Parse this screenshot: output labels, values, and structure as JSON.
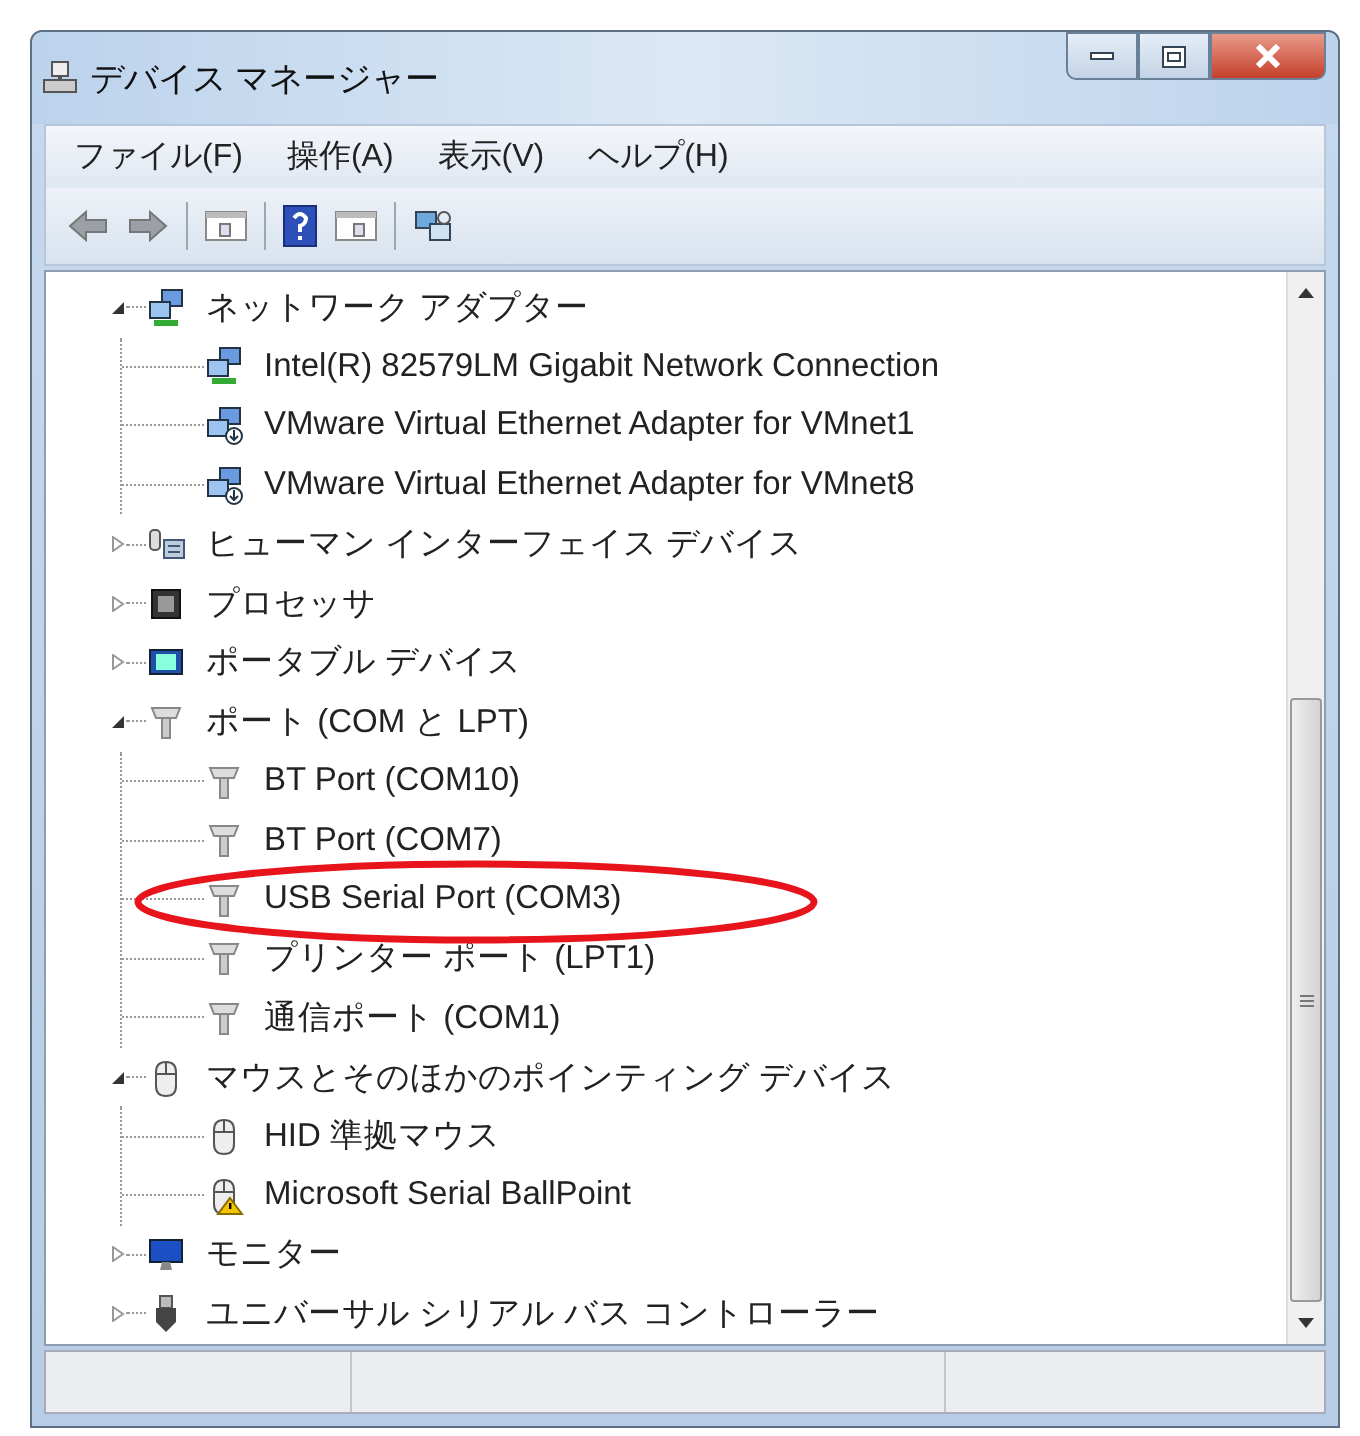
{
  "window": {
    "title": "デバイス マネージャー"
  },
  "menu": [
    "ファイル(F)",
    "操作(A)",
    "表示(V)",
    "ヘルプ(H)"
  ],
  "tree": [
    {
      "label": "ネットワーク アダプター",
      "kind": "network",
      "expanded": true,
      "children": [
        {
          "label": "Intel(R) 82579LM Gigabit Network Connection",
          "kind": "network"
        },
        {
          "label": "VMware Virtual Ethernet Adapter for VMnet1",
          "kind": "network-virtual"
        },
        {
          "label": "VMware Virtual Ethernet Adapter for VMnet8",
          "kind": "network-virtual"
        }
      ]
    },
    {
      "label": "ヒューマン インターフェイス デバイス",
      "kind": "hid",
      "expanded": false
    },
    {
      "label": "プロセッサ",
      "kind": "processor",
      "expanded": false
    },
    {
      "label": "ポータブル デバイス",
      "kind": "portable",
      "expanded": false
    },
    {
      "label": "ポート (COM と LPT)",
      "kind": "port",
      "expanded": true,
      "children": [
        {
          "label": "BT Port (COM10)",
          "kind": "port"
        },
        {
          "label": "BT Port (COM7)",
          "kind": "port"
        },
        {
          "label": "USB Serial Port (COM3)",
          "kind": "port"
        },
        {
          "label": "プリンター ポート (LPT1)",
          "kind": "port"
        },
        {
          "label": "通信ポート (COM1)",
          "kind": "port"
        }
      ]
    },
    {
      "label": "マウスとそのほかのポインティング デバイス",
      "kind": "mouse",
      "expanded": true,
      "children": [
        {
          "label": "HID 準拠マウス",
          "kind": "mouse",
          "warning": false
        },
        {
          "label": "Microsoft Serial BallPoint",
          "kind": "mouse",
          "warning": true
        }
      ]
    },
    {
      "label": "モニター",
      "kind": "monitor",
      "expanded": false
    },
    {
      "label": "ユニバーサル シリアル バス コントローラー",
      "kind": "usb",
      "expanded": false
    }
  ]
}
